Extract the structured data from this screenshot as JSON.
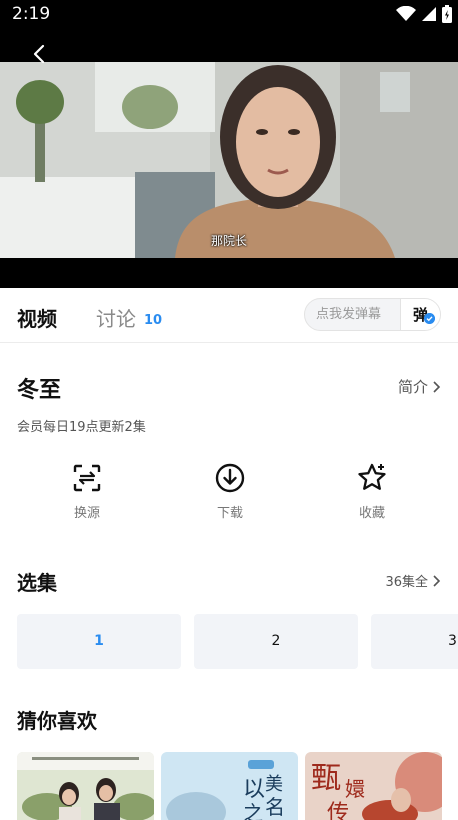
{
  "status_bar": {
    "time": "2:19"
  },
  "player": {
    "subtitle": "那院长"
  },
  "tabs": {
    "video": "视频",
    "discuss": "讨论",
    "discuss_count": "10"
  },
  "danmaku": {
    "placeholder": "点我发弹幕",
    "toggle": "弹"
  },
  "show": {
    "title": "冬至",
    "intro_link": "简介",
    "update_info": "会员每日19点更新2集"
  },
  "actions": [
    {
      "label": "换源",
      "icon": "switch-source-icon"
    },
    {
      "label": "下载",
      "icon": "download-icon"
    },
    {
      "label": "收藏",
      "icon": "favorite-star-icon"
    }
  ],
  "episodes_section": {
    "title": "选集",
    "total": "36集全",
    "episodes": [
      "1",
      "2",
      "3"
    ],
    "selected": "1"
  },
  "recommend": {
    "title": "猜你喜欢",
    "posters": [
      {
        "art": "drama-poster-couple"
      },
      {
        "art": "drama-poster-title-text",
        "lettering": "以美之名"
      },
      {
        "art": "drama-poster-palace",
        "lettering": "甄嬛传"
      }
    ]
  },
  "colors": {
    "accent": "#2a8cf0",
    "status_bar": "#000000",
    "tile_bg": "#f2f4f8"
  }
}
